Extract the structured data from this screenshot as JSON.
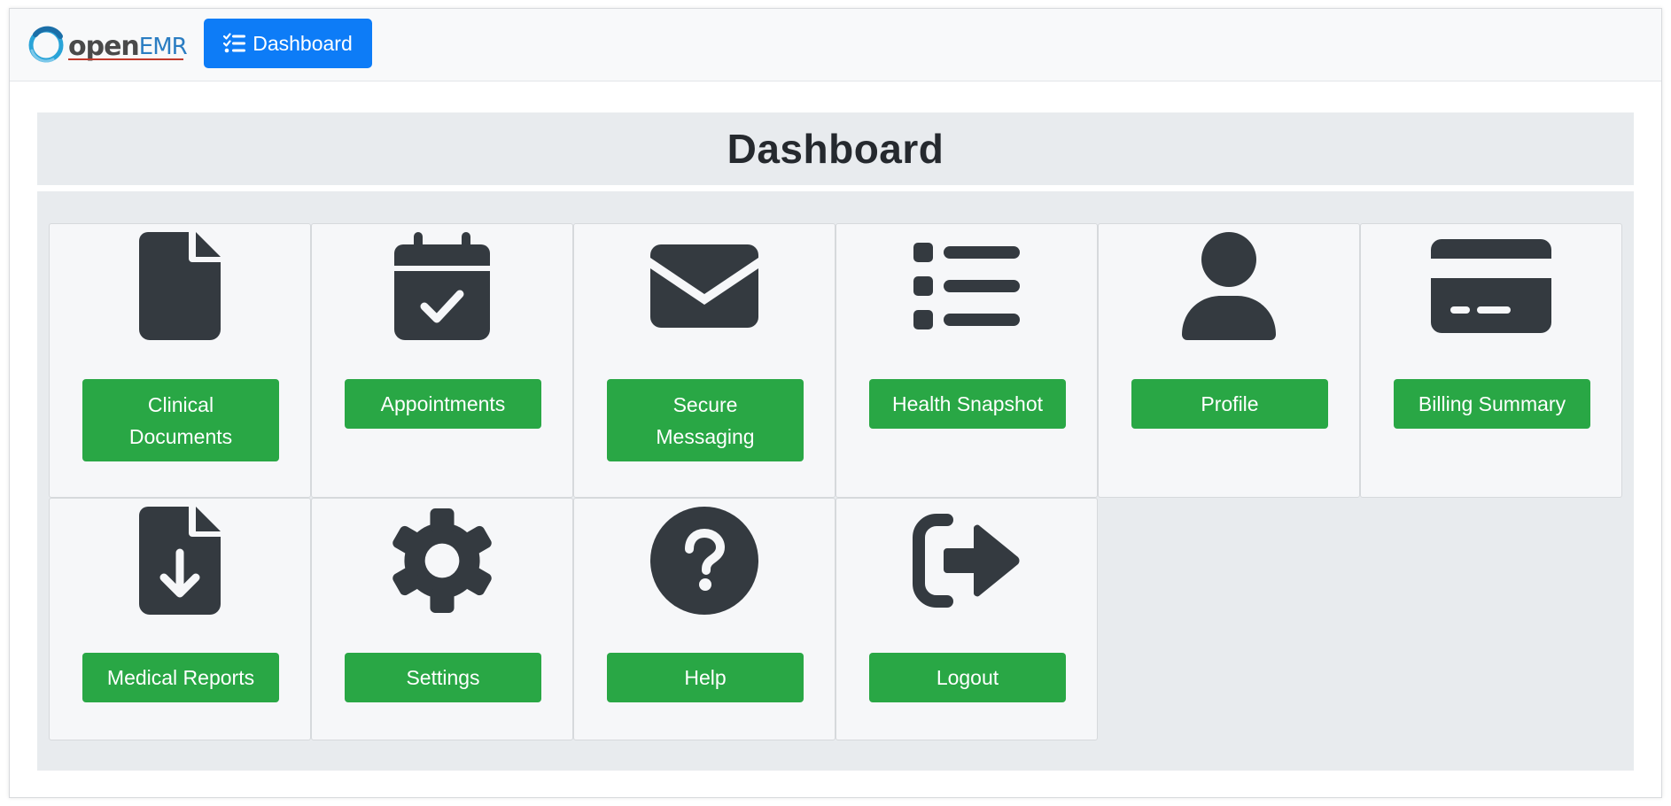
{
  "app": {
    "logo_text_open": "open",
    "logo_text_emr": "EMR"
  },
  "nav": {
    "dashboard_button": "Dashboard",
    "dashboard_icon": "list-check-icon"
  },
  "page": {
    "title": "Dashboard"
  },
  "tiles": [
    {
      "label": "Clinical Documents",
      "icon": "file-icon"
    },
    {
      "label": "Appointments",
      "icon": "calendar-check-icon"
    },
    {
      "label": "Secure Messaging",
      "icon": "envelope-icon"
    },
    {
      "label": "Health Snapshot",
      "icon": "list-icon"
    },
    {
      "label": "Profile",
      "icon": "user-icon"
    },
    {
      "label": "Billing Summary",
      "icon": "credit-card-icon"
    },
    {
      "label": "Medical Reports",
      "icon": "file-download-icon"
    },
    {
      "label": "Settings",
      "icon": "gear-icon"
    },
    {
      "label": "Help",
      "icon": "question-circle-icon"
    },
    {
      "label": "Logout",
      "icon": "sign-out-icon"
    }
  ],
  "colors": {
    "primary": "#0d7cf7",
    "success": "#29a745",
    "icon": "#343a40",
    "panel": "#e8ebee",
    "card": "#f6f7f9"
  }
}
